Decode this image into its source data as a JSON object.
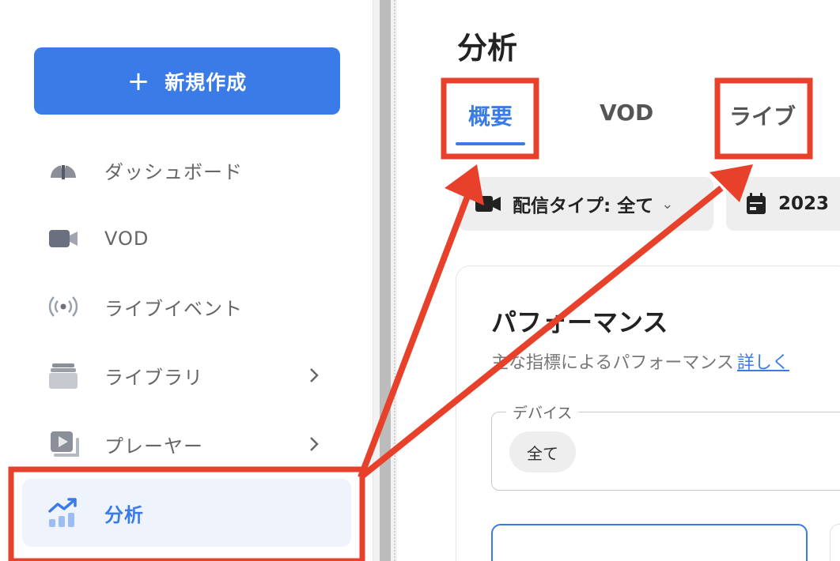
{
  "sidebar": {
    "new_button_label": "新規作成",
    "items": [
      {
        "label": "ダッシュボード",
        "icon": "gauge-icon"
      },
      {
        "label": "VOD",
        "icon": "video-camera-icon"
      },
      {
        "label": "ライブイベント",
        "icon": "broadcast-icon"
      },
      {
        "label": "ライブラリ",
        "icon": "library-icon"
      },
      {
        "label": "プレーヤー",
        "icon": "player-icon"
      },
      {
        "label": "分析",
        "icon": "analytics-chart-icon"
      }
    ]
  },
  "main": {
    "title": "分析",
    "tabs": [
      {
        "label": "概要"
      },
      {
        "label": "VOD"
      },
      {
        "label": "ライブ"
      }
    ],
    "filters": {
      "type_label": "配信タイプ: 全て",
      "date_label": "2023"
    },
    "performance": {
      "title": "パフォーマンス",
      "subtitle": "主な指標によるパフォーマンス",
      "link": "詳しく",
      "device_legend": "デバイス",
      "device_value": "全て"
    }
  },
  "colors": {
    "accent": "#3a7be8",
    "annotation": "#e8412b"
  }
}
